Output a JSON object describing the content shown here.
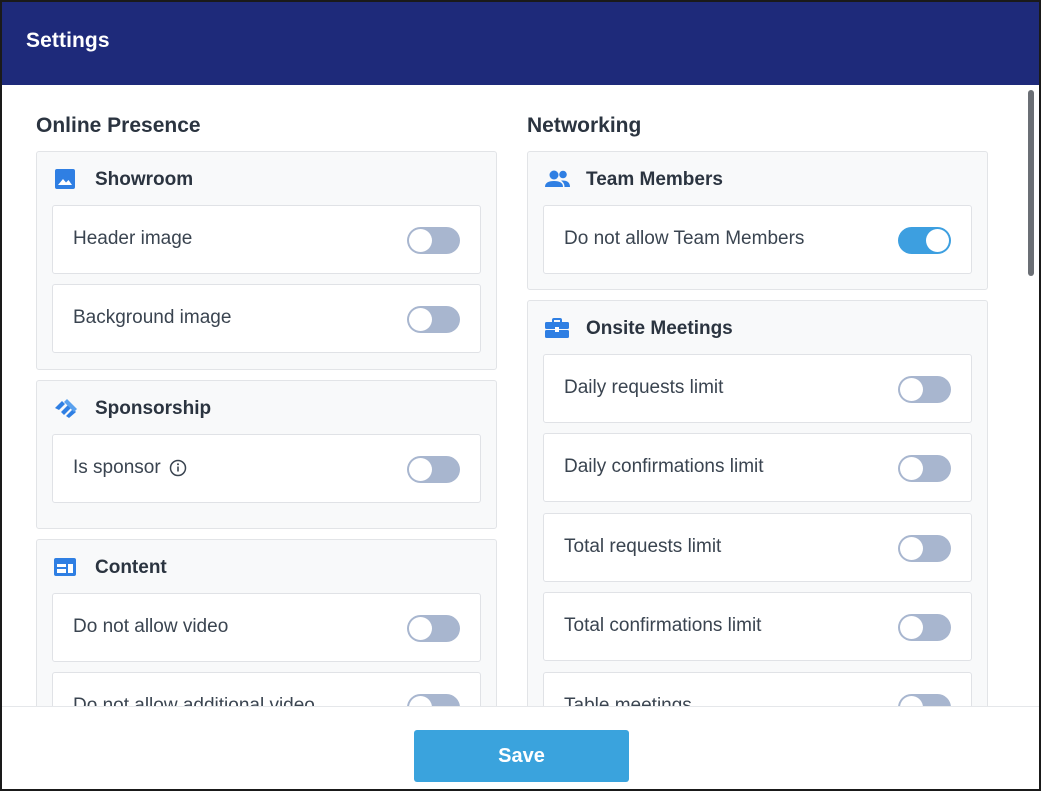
{
  "window": {
    "title": "Settings"
  },
  "colors": {
    "header_bg": "#1e2a7a",
    "accent": "#3d9fe0",
    "toggle_off": "#a8b6cf",
    "save_button": "#3aa3dd"
  },
  "online_presence": {
    "title": "Online Presence",
    "showroom": {
      "title": "Showroom",
      "icon": "image-icon",
      "items": [
        {
          "label": "Header image",
          "enabled": false
        },
        {
          "label": "Background image",
          "enabled": false
        }
      ]
    },
    "sponsorship": {
      "title": "Sponsorship",
      "icon": "handshake-icon",
      "items": [
        {
          "label": "Is sponsor",
          "enabled": false,
          "info_icon": "info-icon"
        }
      ]
    },
    "content": {
      "title": "Content",
      "icon": "web-content-icon",
      "items": [
        {
          "label": "Do not allow video",
          "enabled": false
        },
        {
          "label": "Do not allow additional video",
          "enabled": false
        }
      ]
    }
  },
  "networking": {
    "title": "Networking",
    "team_members": {
      "title": "Team Members",
      "icon": "people-icon",
      "items": [
        {
          "label": "Do not allow Team Members",
          "enabled": true
        }
      ]
    },
    "onsite_meetings": {
      "title": "Onsite Meetings",
      "icon": "briefcase-icon",
      "items": [
        {
          "label": "Daily requests limit",
          "enabled": false
        },
        {
          "label": "Daily confirmations limit",
          "enabled": false
        },
        {
          "label": "Total requests limit",
          "enabled": false
        },
        {
          "label": "Total confirmations limit",
          "enabled": false
        },
        {
          "label": "Table meetings",
          "enabled": false
        }
      ]
    }
  },
  "footer": {
    "save_label": "Save"
  }
}
